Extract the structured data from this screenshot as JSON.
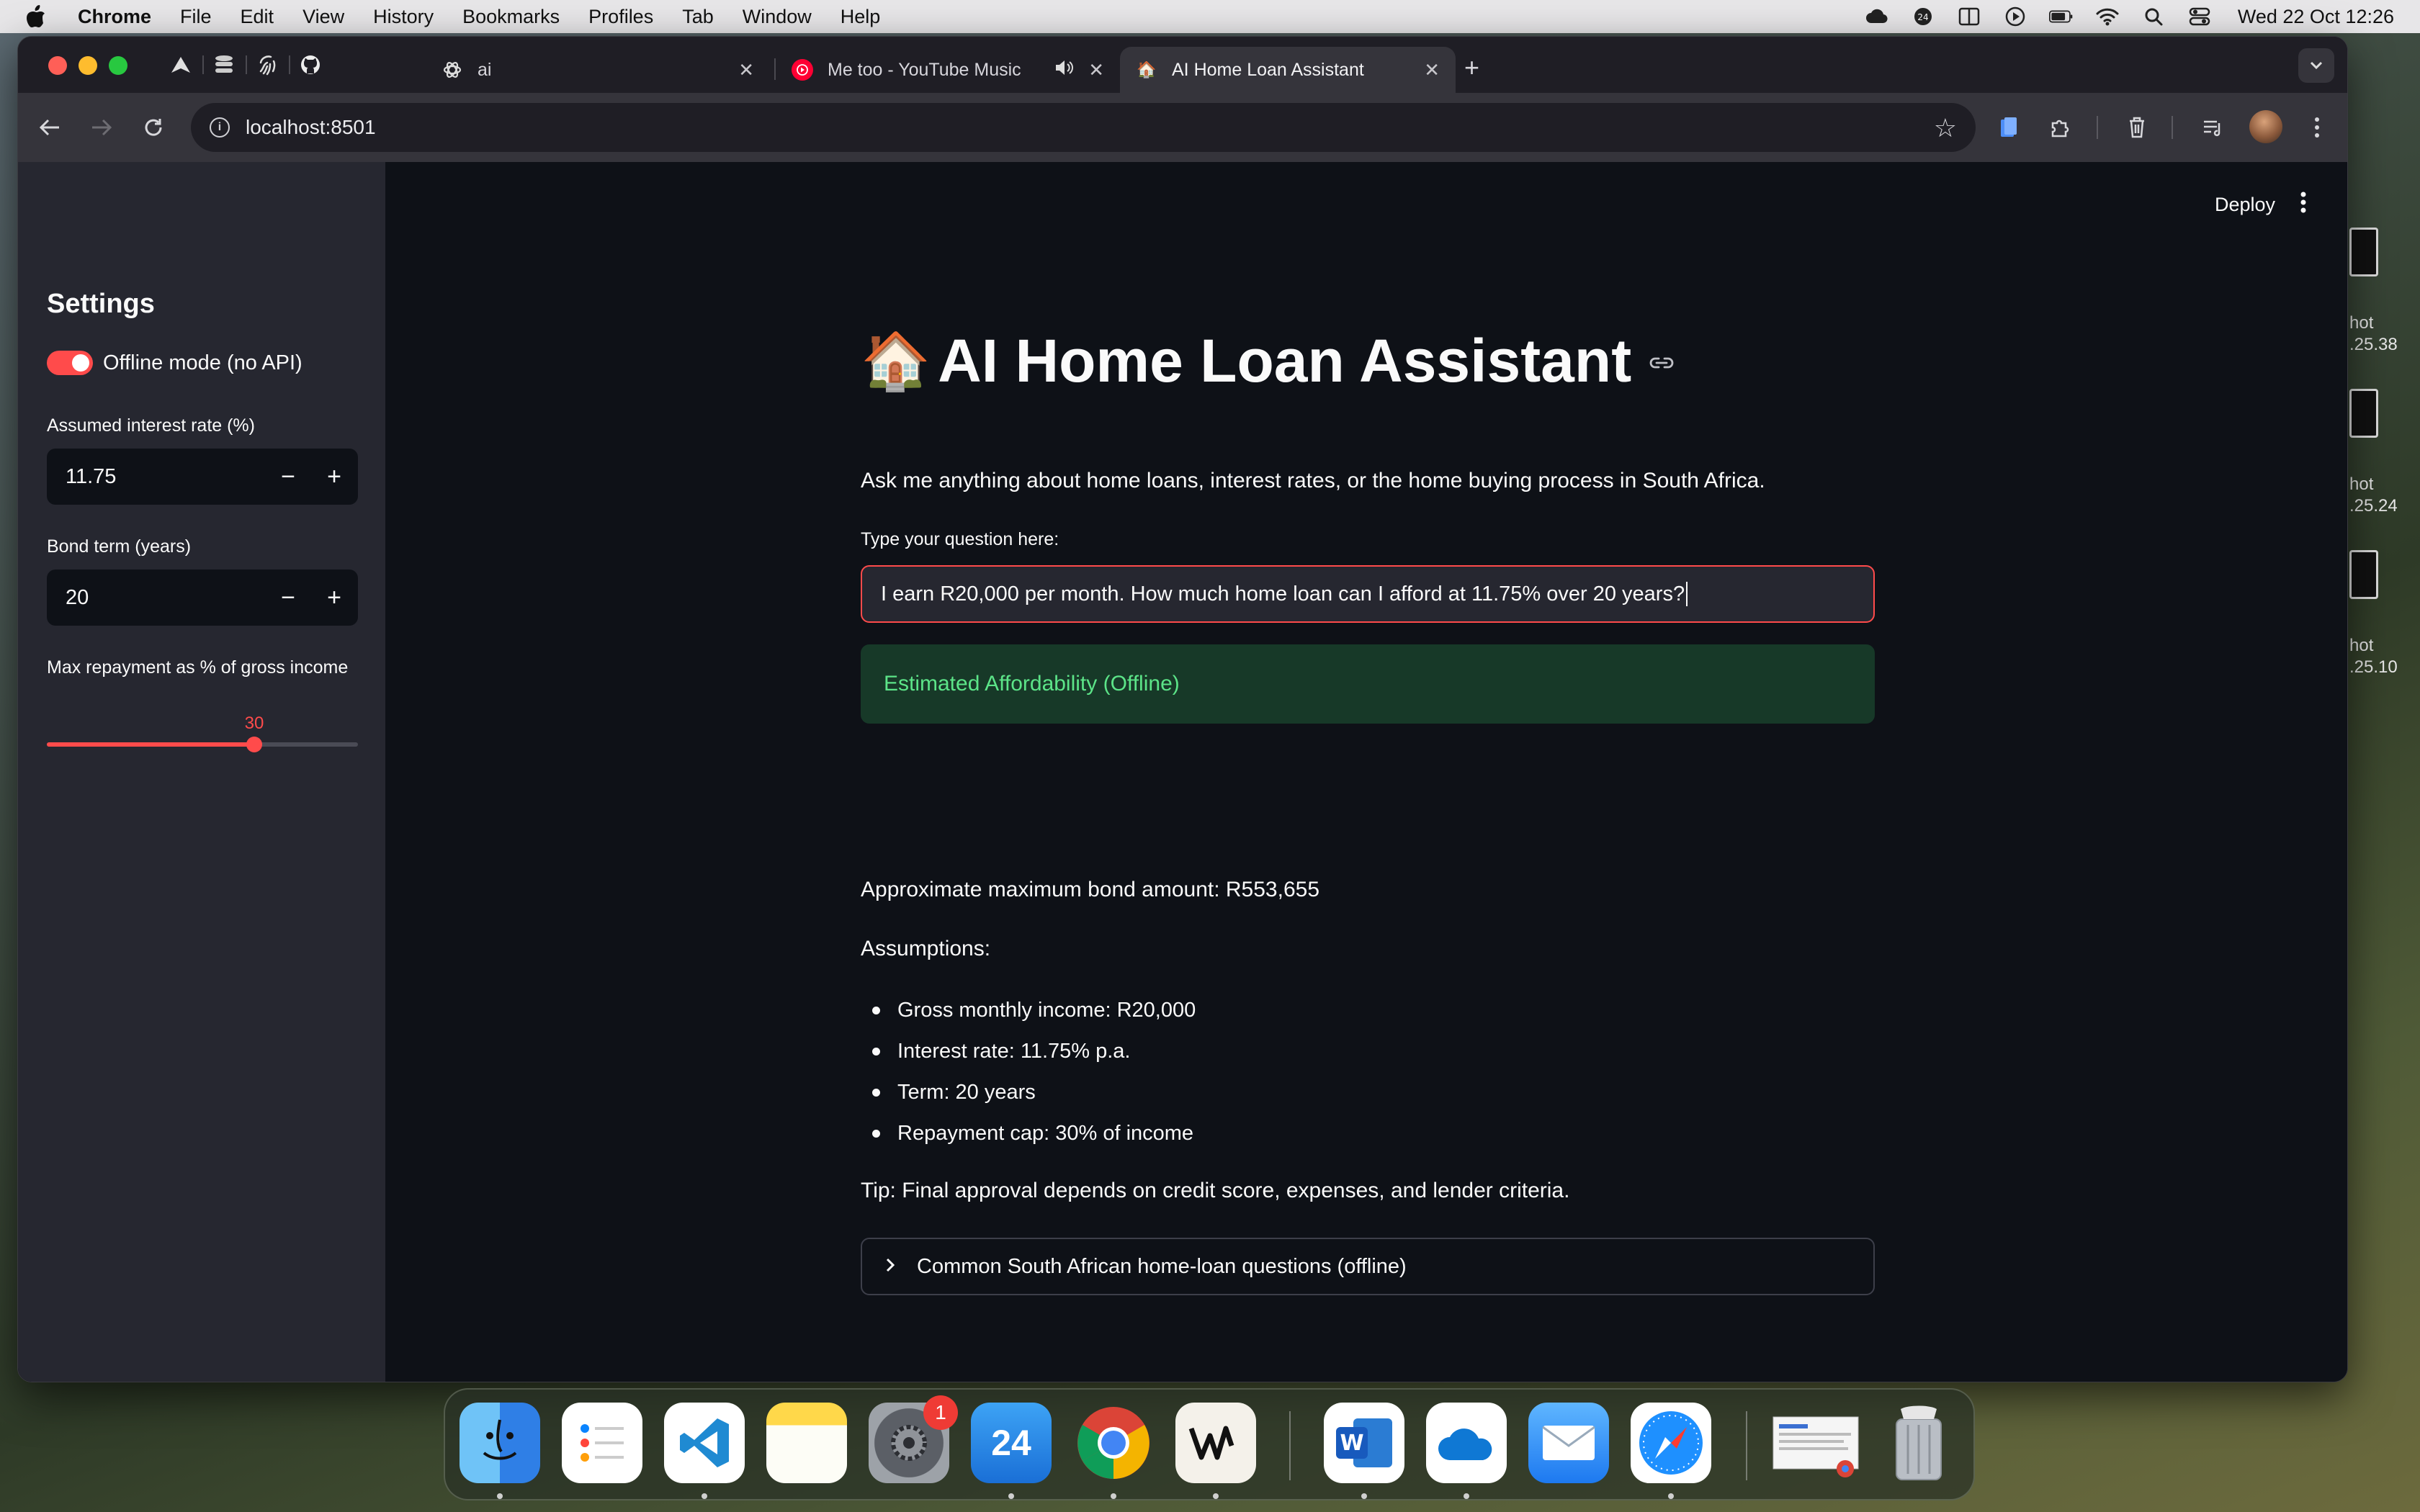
{
  "menubar": {
    "app_name": "Chrome",
    "items": [
      "File",
      "Edit",
      "View",
      "History",
      "Bookmarks",
      "Profiles",
      "Tab",
      "Window",
      "Help"
    ],
    "clock": "Wed 22 Oct  12:26",
    "status_icons": [
      "creative-cloud-icon",
      "24-hour-icon",
      "screen-mirror-icon",
      "play-icon",
      "battery-icon",
      "wifi-icon",
      "spotlight-search-icon",
      "control-center-icon"
    ]
  },
  "desktop": {
    "screenshots": [
      {
        "line1": "hot",
        "line2": ".25.38"
      },
      {
        "line1": "hot",
        "line2": ".25.24"
      },
      {
        "line1": "hot",
        "line2": ".25.10"
      }
    ]
  },
  "browser": {
    "pinned_tabs": [
      "bird-logo-icon",
      "database-icon",
      "fingerprint-icon",
      "github-icon"
    ],
    "tabs": [
      {
        "title": "ai",
        "icon": "openai-icon"
      },
      {
        "title": "Me too - YouTube Music",
        "icon": "youtube-music-icon"
      },
      {
        "title": "AI Home Loan Assistant",
        "icon": "house-icon",
        "active": true
      }
    ],
    "url": "localhost:8501"
  },
  "sidebar": {
    "title": "Settings",
    "offline_toggle_label": "Offline mode (no API)",
    "offline_toggle_on": true,
    "interest_label": "Assumed interest rate (%)",
    "interest_value": "11.75",
    "term_label": "Bond term (years)",
    "term_value": "20",
    "repayment_label": "Max repayment as % of gross income",
    "repayment_value": "30",
    "repayment_min": 0,
    "repayment_max": 45,
    "minus": "−",
    "plus": "+"
  },
  "header": {
    "deploy": "Deploy"
  },
  "main": {
    "title": "AI Home Loan Assistant",
    "title_emoji": "🏠",
    "subtitle": "Ask me anything about home loans, interest rates, or the home buying process in South Africa.",
    "question_label": "Type your question here:",
    "question_value": "I earn R20,000 per month. How much home loan can I afford at 11.75% over 20 years?",
    "success_message": "Estimated Affordability (Offline)",
    "max_bond": "Approximate maximum bond amount: R553,655",
    "assumptions_heading": "Assumptions:",
    "assumptions": [
      "Gross monthly income: R20,000",
      "Interest rate: 11.75% p.a.",
      "Term: 20 years",
      "Repayment cap: 30% of income"
    ],
    "tip": "Tip: Final approval depends on credit score, expenses, and lender criteria.",
    "expander_label": "Common South African home-loan questions (offline)"
  },
  "dock": {
    "apps": [
      "finder",
      "reminders",
      "visual-studio-code",
      "notes",
      "system-settings",
      "fantastical",
      "google-chrome",
      "wispr",
      "microsoft-word",
      "onedrive",
      "mail",
      "safari",
      "downloads-stack",
      "trash"
    ],
    "system_settings_badge": "1",
    "fantastical_label": "24"
  }
}
